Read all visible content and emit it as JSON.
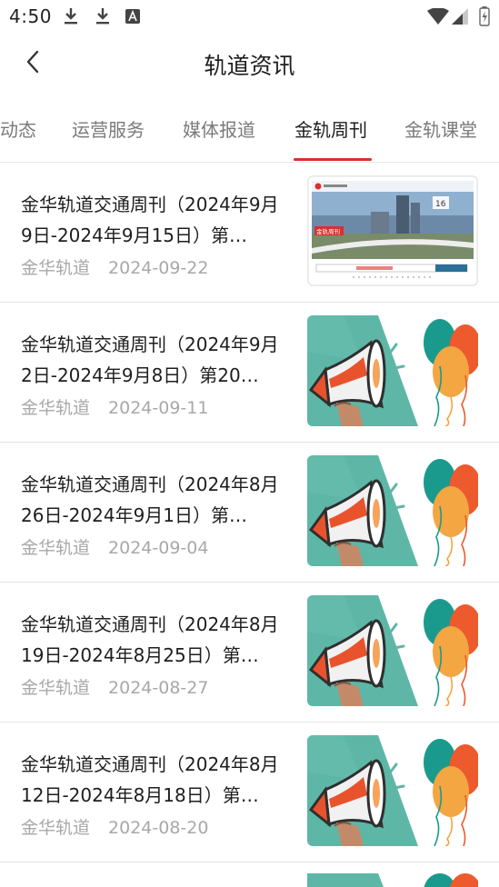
{
  "status_bar": {
    "time": "4:50",
    "icons": [
      "download-icon",
      "download-icon",
      "font-icon",
      "wifi-icon",
      "signal-icon",
      "battery-charging-icon"
    ]
  },
  "header": {
    "title": "轨道资讯",
    "back_icon": "chevron-left-icon"
  },
  "tabs": [
    {
      "label": "动态",
      "active": false
    },
    {
      "label": "运营服务",
      "active": false
    },
    {
      "label": "媒体报道",
      "active": false
    },
    {
      "label": "金轨周刊",
      "active": true
    },
    {
      "label": "金轨课堂",
      "active": false
    }
  ],
  "accent_color": "#d9302b",
  "articles": [
    {
      "title": "金华轨道交通周刊（2024年9月9日-2024年9月15日）第…",
      "source": "金华轨道",
      "date": "2024-09-22",
      "thumbnail": "weekly-cover",
      "thumb_texts": {
        "date_num": "16",
        "badge": "金轨周刊"
      }
    },
    {
      "title": "金华轨道交通周刊（2024年9月2日-2024年9月8日）第20…",
      "source": "金华轨道",
      "date": "2024-09-11",
      "thumbnail": "megaphone-balloons"
    },
    {
      "title": "金华轨道交通周刊（2024年8月26日-2024年9月1日）第…",
      "source": "金华轨道",
      "date": "2024-09-04",
      "thumbnail": "megaphone-balloons"
    },
    {
      "title": "金华轨道交通周刊（2024年8月19日-2024年8月25日）第…",
      "source": "金华轨道",
      "date": "2024-08-27",
      "thumbnail": "megaphone-balloons"
    },
    {
      "title": "金华轨道交通周刊（2024年8月12日-2024年8月18日）第…",
      "source": "金华轨道",
      "date": "2024-08-20",
      "thumbnail": "megaphone-balloons"
    }
  ]
}
